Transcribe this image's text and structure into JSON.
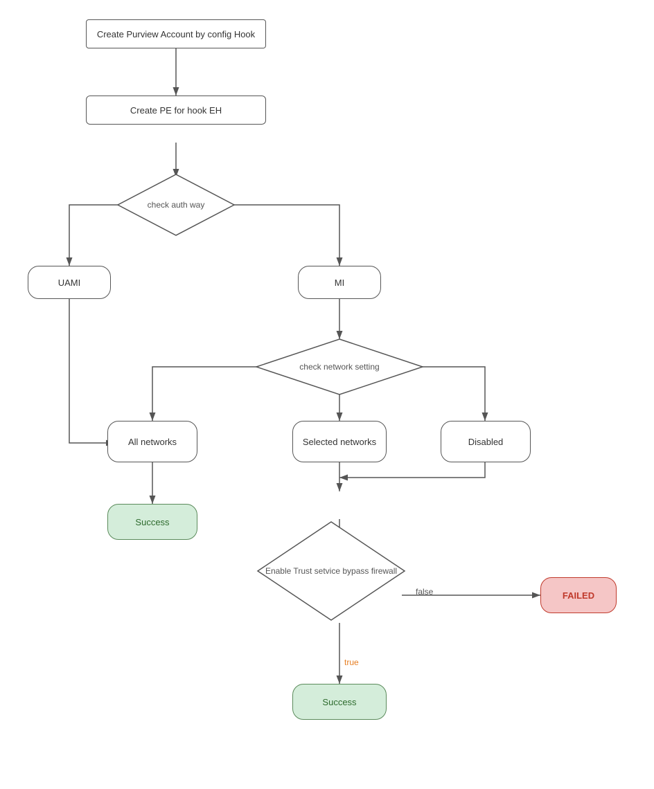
{
  "nodes": {
    "create_purview": {
      "label": "Create Purview Account by config Hook"
    },
    "create_pe": {
      "label": "Create PE for hook EH"
    },
    "check_auth": {
      "label": "check auth way"
    },
    "uami": {
      "label": "UAMI"
    },
    "mi": {
      "label": "MI"
    },
    "check_network": {
      "label": "check network setting"
    },
    "all_networks": {
      "label": "All networks"
    },
    "selected_networks": {
      "label": "Selected networks"
    },
    "disabled": {
      "label": "Disabled"
    },
    "success1": {
      "label": "Success"
    },
    "enable_trust": {
      "label": "Enable Trust setvice\nbypass firewall"
    },
    "failed": {
      "label": "FAILED"
    },
    "success2": {
      "label": "Success"
    }
  },
  "labels": {
    "true": "true",
    "false": "false"
  }
}
